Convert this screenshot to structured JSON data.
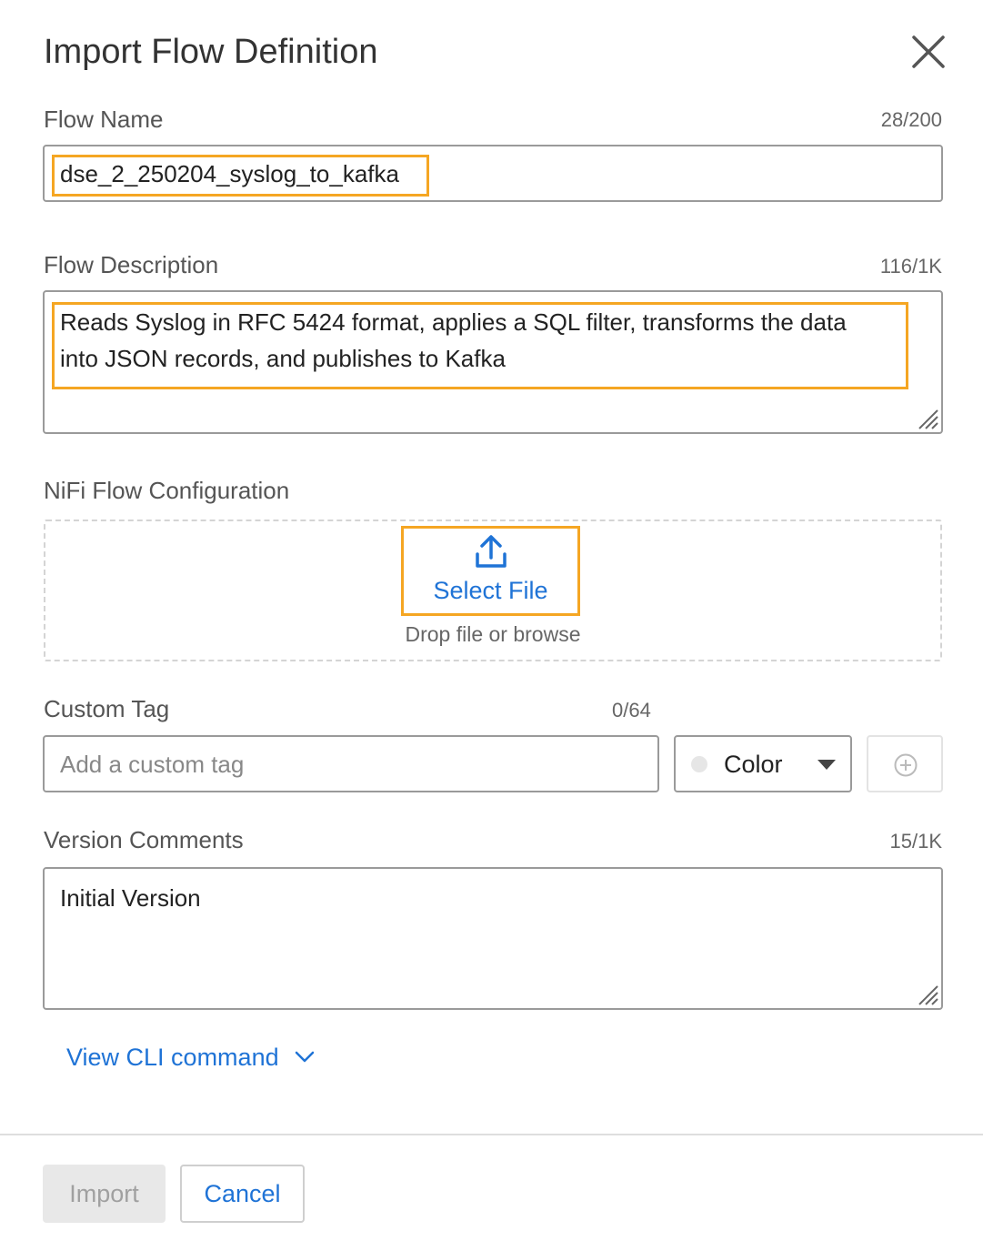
{
  "dialog": {
    "title": "Import Flow Definition"
  },
  "flow_name": {
    "label": "Flow Name",
    "counter": "28/200",
    "value": "dse_2_250204_syslog_to_kafka"
  },
  "flow_description": {
    "label": "Flow Description",
    "counter": "116/1K",
    "line1": "Reads Syslog in RFC 5424 format, applies a SQL filter, transforms the data",
    "line2": "into JSON records, and publishes to Kafka"
  },
  "nifi_config": {
    "label": "NiFi Flow Configuration",
    "select_file_label": "Select File",
    "hint": "Drop file or browse",
    "icon": "upload-icon"
  },
  "custom_tag": {
    "label": "Custom Tag",
    "counter": "0/64",
    "placeholder": "Add a custom tag",
    "color_label": "Color",
    "color_swatch": "#e6e6e6"
  },
  "version_comments": {
    "label": "Version Comments",
    "counter": "15/1K",
    "value": "Initial Version"
  },
  "cli": {
    "link_label": "View CLI command"
  },
  "footer": {
    "import_label": "Import",
    "cancel_label": "Cancel"
  },
  "colors": {
    "accent": "#1f73d6",
    "highlight": "#f5a623"
  }
}
